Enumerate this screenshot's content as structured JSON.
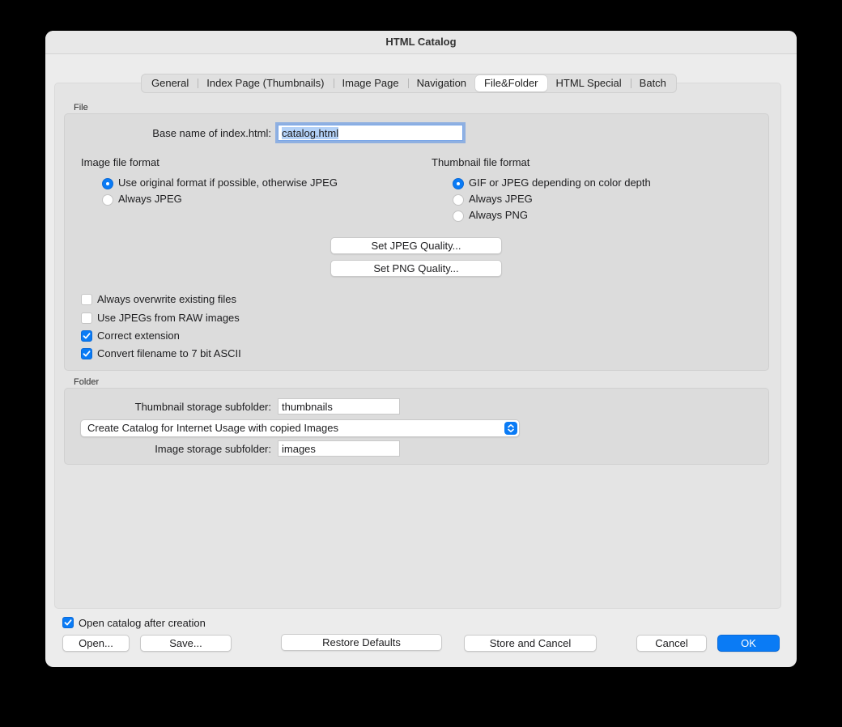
{
  "window": {
    "title": "HTML Catalog"
  },
  "tabs": [
    {
      "label": "General"
    },
    {
      "label": "Index Page (Thumbnails)"
    },
    {
      "label": "Image Page"
    },
    {
      "label": "Navigation"
    },
    {
      "label": "File&Folder",
      "active": true
    },
    {
      "label": "HTML Special"
    },
    {
      "label": "Batch"
    }
  ],
  "file": {
    "section_label": "File",
    "base_name_label": "Base name of index.html:",
    "base_name_value": "catalog.html",
    "image_format": {
      "title": "Image file format",
      "options": [
        {
          "label": "Use original format if possible, otherwise JPEG",
          "selected": true
        },
        {
          "label": "Always JPEG",
          "selected": false
        }
      ]
    },
    "thumbnail_format": {
      "title": "Thumbnail file format",
      "options": [
        {
          "label": "GIF or JPEG depending on color depth",
          "selected": true
        },
        {
          "label": "Always JPEG",
          "selected": false
        },
        {
          "label": "Always PNG",
          "selected": false
        }
      ]
    },
    "jpeg_quality_button": "Set JPEG Quality...",
    "png_quality_button": "Set PNG Quality...",
    "checkboxes": [
      {
        "label": "Always overwrite existing files",
        "checked": false
      },
      {
        "label": "Use JPEGs from RAW images",
        "checked": false
      },
      {
        "label": "Correct extension",
        "checked": true
      },
      {
        "label": "Convert filename to 7 bit ASCII",
        "checked": true
      }
    ]
  },
  "folder": {
    "section_label": "Folder",
    "thumb_subfolder_label": "Thumbnail storage subfolder:",
    "thumb_subfolder_value": "thumbnails",
    "catalog_mode_selected": "Create Catalog for Internet Usage with copied Images",
    "image_subfolder_label": "Image storage subfolder:",
    "image_subfolder_value": "images"
  },
  "footer": {
    "open_after_label": "Open catalog after creation",
    "open_after_checked": true,
    "open_button": "Open...",
    "save_button": "Save...",
    "restore_button": "Restore Defaults",
    "store_cancel_button": "Store and Cancel",
    "cancel_button": "Cancel",
    "ok_button": "OK"
  },
  "colors": {
    "accent": "#0a7bf5",
    "focus_ring": "#508ce6"
  }
}
